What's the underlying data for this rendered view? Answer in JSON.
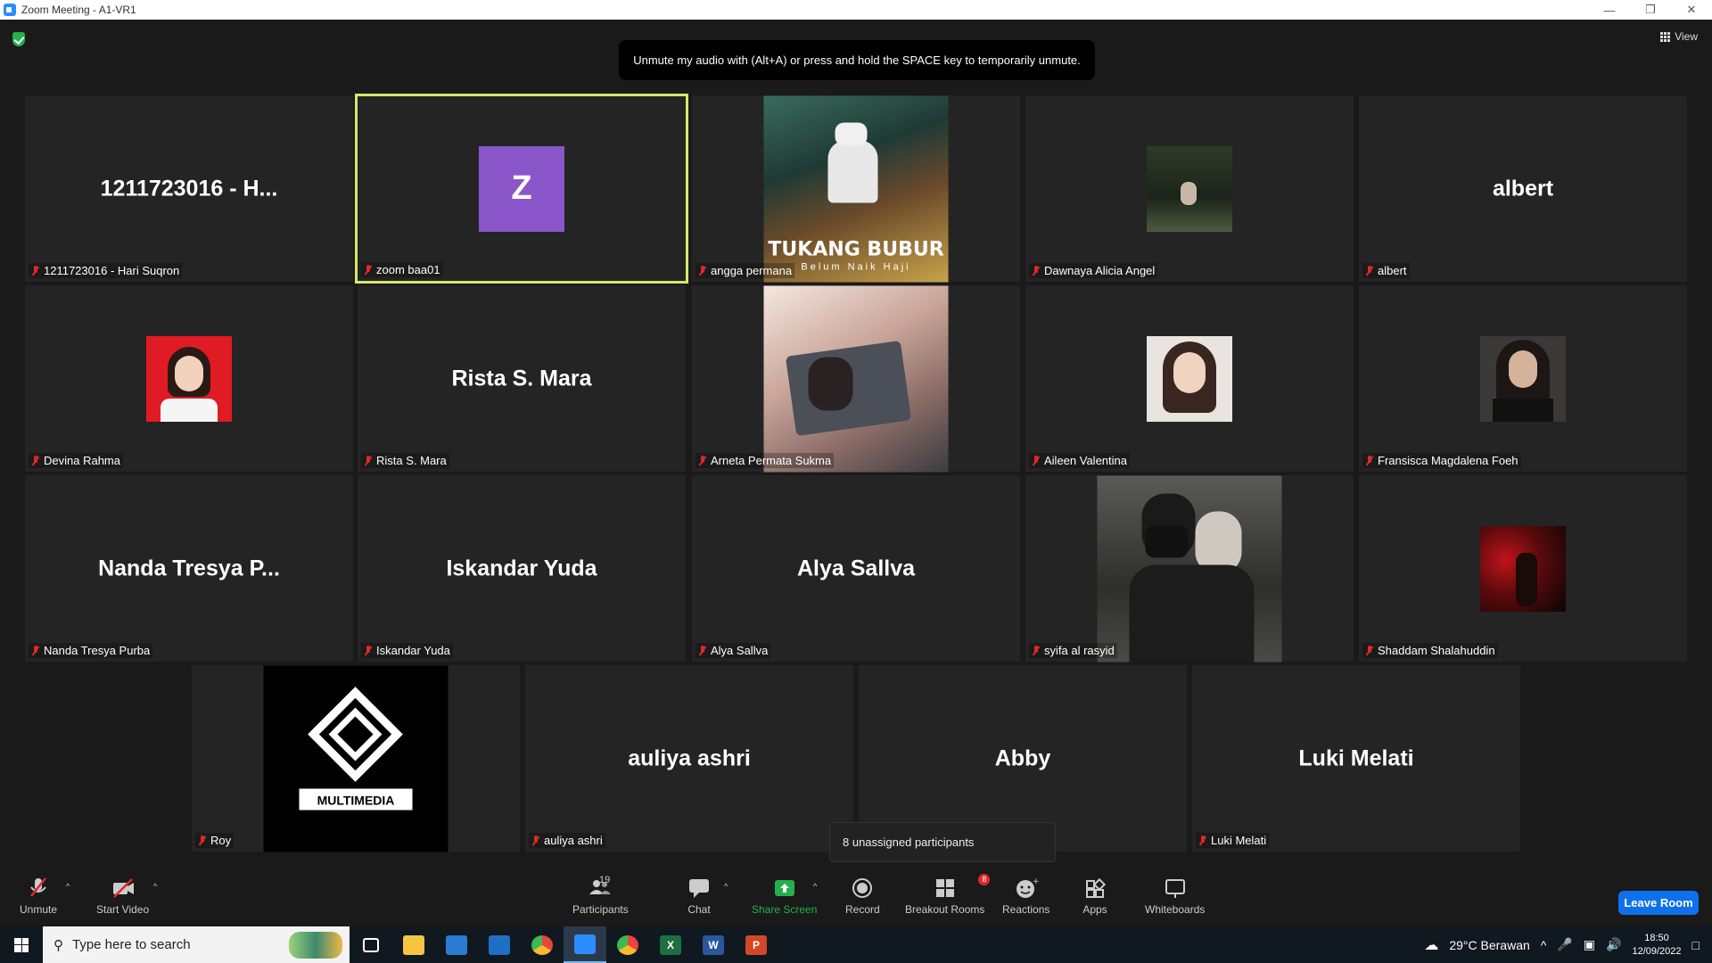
{
  "window": {
    "title": "Zoom Meeting - A1-VR1"
  },
  "meeting": {
    "toast": "Unmute my audio with (Alt+A) or press and hold the SPACE key to temporarily unmute.",
    "view_label": "View",
    "unassigned": "8 unassigned participants",
    "tiles": [
      {
        "big": "1211723016 - H...",
        "label": "1211723016 - Hari Suqron"
      },
      {
        "big": "",
        "label": "zoom baa01",
        "avatar": "Z"
      },
      {
        "big": "",
        "label": "angga permana",
        "photo_text": "TUKANG BUBUR",
        "photo_sub": "Belum Naik Haji"
      },
      {
        "big": "",
        "label": "Dawnaya Alicia Angel"
      },
      {
        "big": "albert",
        "label": "albert"
      },
      {
        "big": "",
        "label": "Devina Rahma"
      },
      {
        "big": "Rista S. Mara",
        "label": "Rista S. Mara"
      },
      {
        "big": "",
        "label": "Arneta Permata Sukma"
      },
      {
        "big": "",
        "label": "Aileen Valentina"
      },
      {
        "big": "",
        "label": "Fransisca Magdalena Foeh"
      },
      {
        "big": "Nanda Tresya P...",
        "label": "Nanda Tresya Purba"
      },
      {
        "big": "Iskandar Yuda",
        "label": "Iskandar Yuda"
      },
      {
        "big": "Alya Sallva",
        "label": "Alya Sallva"
      },
      {
        "big": "",
        "label": "syifa al rasyid"
      },
      {
        "big": "",
        "label": "Shaddam Shalahuddin"
      },
      {
        "big": "",
        "label": "Roy",
        "logo_text": "MULTIMEDIA"
      },
      {
        "big": "auliya ashri",
        "label": "auliya ashri"
      },
      {
        "big": "Abby",
        "label": ""
      },
      {
        "big": "Luki Melati",
        "label": "Luki Melati"
      }
    ]
  },
  "toolbar": {
    "unmute": "Unmute",
    "start_video": "Start Video",
    "participants": "Participants",
    "participants_count": "19",
    "chat": "Chat",
    "share_screen": "Share Screen",
    "record": "Record",
    "breakout": "Breakout Rooms",
    "breakout_badge": "8",
    "reactions": "Reactions",
    "apps": "Apps",
    "whiteboards": "Whiteboards",
    "leave": "Leave Room"
  },
  "taskbar": {
    "search_placeholder": "Type here to search",
    "weather": "29°C  Berawan",
    "time": "18:50",
    "date": "12/09/2022"
  },
  "colors": {
    "accent": "#0e71eb",
    "muted_red": "#e02828",
    "active_border": "#d7e76b",
    "share_green": "#22b14c"
  }
}
